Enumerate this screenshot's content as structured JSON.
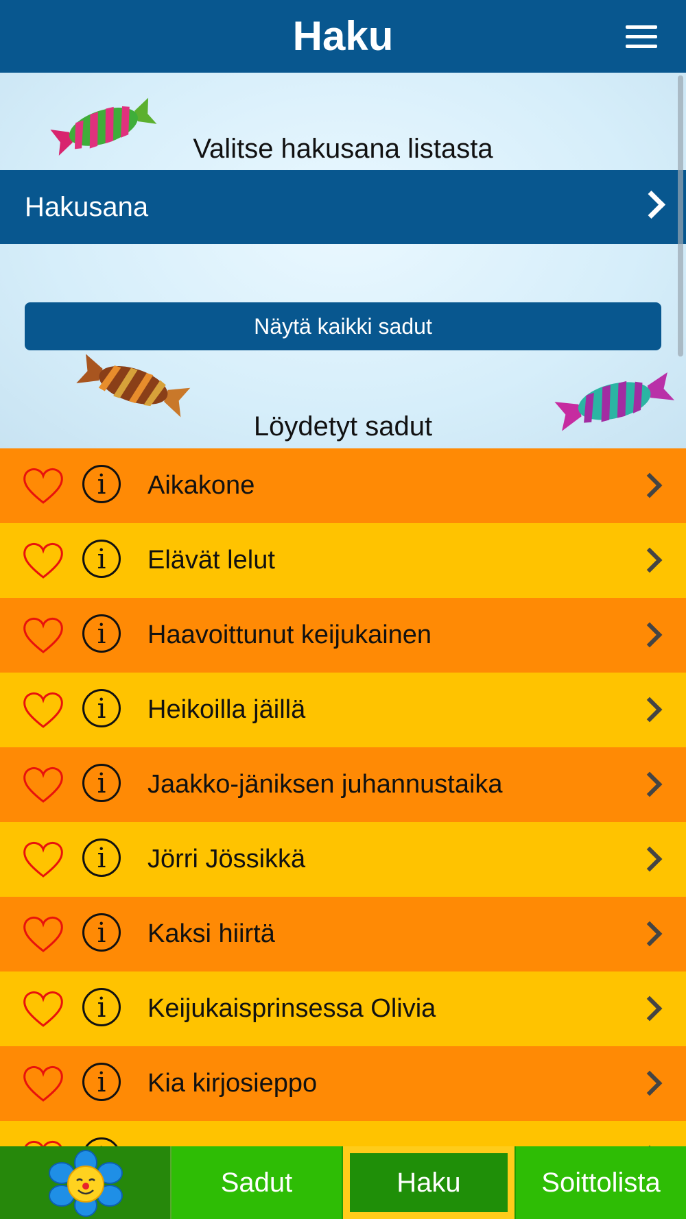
{
  "header": {
    "title": "Haku",
    "menu_icon": "hamburger-menu-icon"
  },
  "search": {
    "prompt": "Valitse hakusana listasta",
    "field_label": "Hakusana",
    "show_all_label": "Näytä kaikki sadut"
  },
  "results": {
    "heading": "Löydetyt sadut",
    "items": [
      {
        "title": "Aikakone",
        "color": "#ff8a05"
      },
      {
        "title": "Elävät lelut",
        "color": "#ffc300"
      },
      {
        "title": "Haavoittunut keijukainen",
        "color": "#ff8a05"
      },
      {
        "title": "Heikoilla jäillä",
        "color": "#ffc300"
      },
      {
        "title": "Jaakko-jäniksen juhannustaika",
        "color": "#ff8a05"
      },
      {
        "title": "Jörri Jössikkä",
        "color": "#ffc300"
      },
      {
        "title": "Kaksi hiirtä",
        "color": "#ff8a05"
      },
      {
        "title": "Keijukaisprinsessa Olivia",
        "color": "#ffc300"
      },
      {
        "title": "Kia kirjosieppo",
        "color": "#ff8a05"
      }
    ]
  },
  "tabs": {
    "sadut": "Sadut",
    "haku": "Haku",
    "soittolista": "Soittolista"
  },
  "colors": {
    "primary": "#08578f",
    "tab_green": "#2ebd05",
    "tab_active": "#1f8f08",
    "row_orange": "#ff8a05",
    "row_yellow": "#ffc300"
  }
}
